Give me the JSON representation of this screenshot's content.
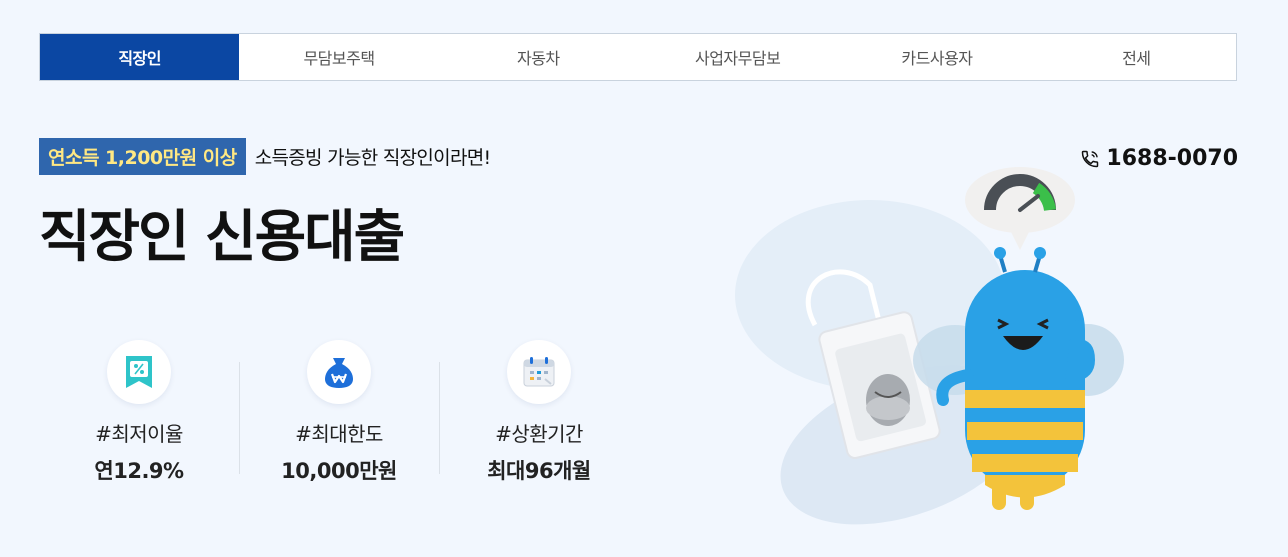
{
  "tabs": [
    {
      "label": "직장인",
      "active": true
    },
    {
      "label": "무담보주택",
      "active": false
    },
    {
      "label": "자동차",
      "active": false
    },
    {
      "label": "사업자무담보",
      "active": false
    },
    {
      "label": "카드사용자",
      "active": false
    },
    {
      "label": "전세",
      "active": false
    }
  ],
  "hero": {
    "badge": "연소득 1,200만원 이상",
    "tagline": "소득증빙 가능한 직장인이라면!",
    "title": "직장인 신용대출",
    "phone": "1688-0070"
  },
  "features": [
    {
      "icon": "percent-tag-icon",
      "label": "#최저이율",
      "value": "연12.9%"
    },
    {
      "icon": "money-bag-icon",
      "label": "#최대한도",
      "value": "10,000만원"
    },
    {
      "icon": "calendar-icon",
      "label": "#상환기간",
      "value": "최대96개월"
    }
  ],
  "colors": {
    "accent": "#0b47a3",
    "badge_bg": "#2f66ad",
    "badge_text": "#ffe883",
    "background": "#f2f7fe"
  }
}
